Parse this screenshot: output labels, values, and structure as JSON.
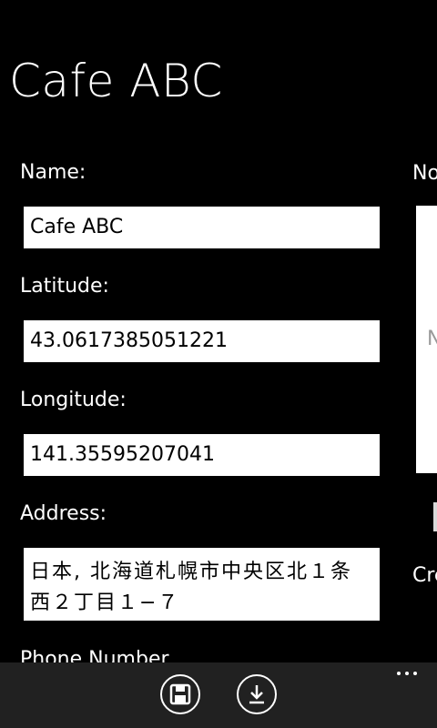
{
  "page": {
    "title": "Cafe ABC"
  },
  "form": {
    "name_label": "Name:",
    "name_value": "Cafe ABC",
    "latitude_label": "Latitude:",
    "latitude_value": "43.0617385051221",
    "longitude_label": "Longitude:",
    "longitude_value": "141.35595207041",
    "address_label": "Address:",
    "address_value": "日本, 北海道札幌市中央区北１条西２丁目１−７",
    "phone_label": "Phone Number"
  },
  "next_pivot": {
    "label_fragment": "No",
    "box_placeholder_fragment": "N",
    "label2_fragment": "Cre"
  },
  "app_bar": {
    "buttons": [
      {
        "icon": "save-icon"
      },
      {
        "icon": "download-icon"
      }
    ],
    "more_icon": "ellipsis-icon"
  },
  "colors": {
    "background": "#000000",
    "app_bar": "#212121",
    "text": "#ffffff",
    "field": "#ffffff"
  }
}
